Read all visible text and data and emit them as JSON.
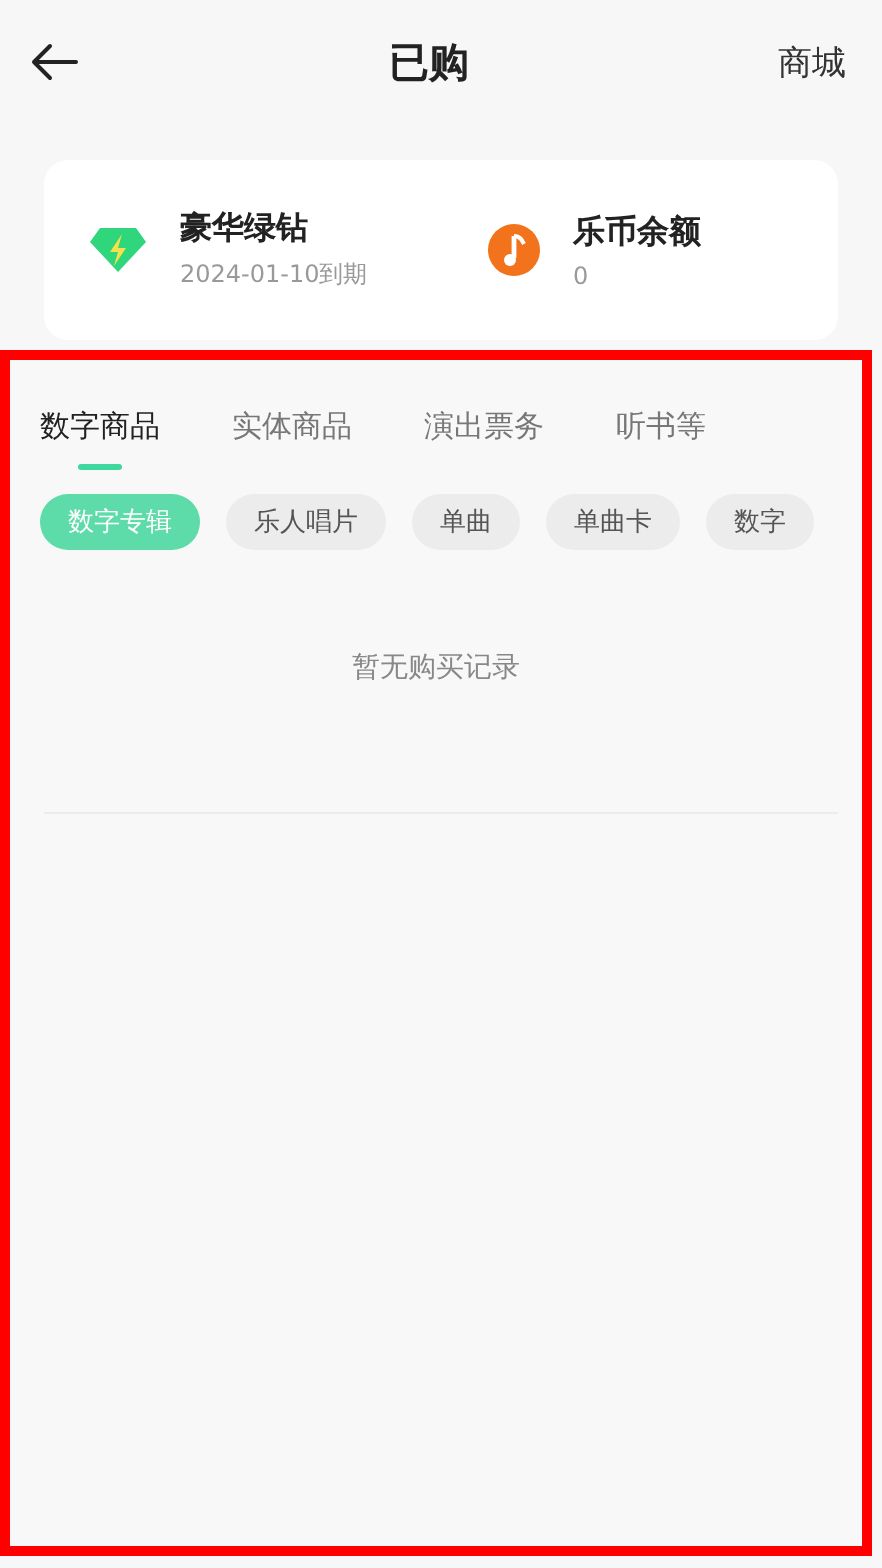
{
  "header": {
    "title": "已购",
    "action": "商城"
  },
  "summary": [
    {
      "kind": "vip",
      "title": "豪华绿钻",
      "subtitle": "2024-01-10到期"
    },
    {
      "kind": "coin",
      "title": "乐币余额",
      "subtitle": "0"
    }
  ],
  "tabs": [
    {
      "label": "数字商品",
      "selected": true
    },
    {
      "label": "实体商品",
      "selected": false
    },
    {
      "label": "演出票务",
      "selected": false
    },
    {
      "label": "听书等",
      "selected": false
    }
  ],
  "chips": [
    {
      "label": "数字专辑",
      "selected": true
    },
    {
      "label": "乐人唱片",
      "selected": false
    },
    {
      "label": "单曲",
      "selected": false
    },
    {
      "label": "单曲卡",
      "selected": false
    },
    {
      "label": "数字",
      "selected": false
    }
  ],
  "empty_message": "暂无购买记录"
}
